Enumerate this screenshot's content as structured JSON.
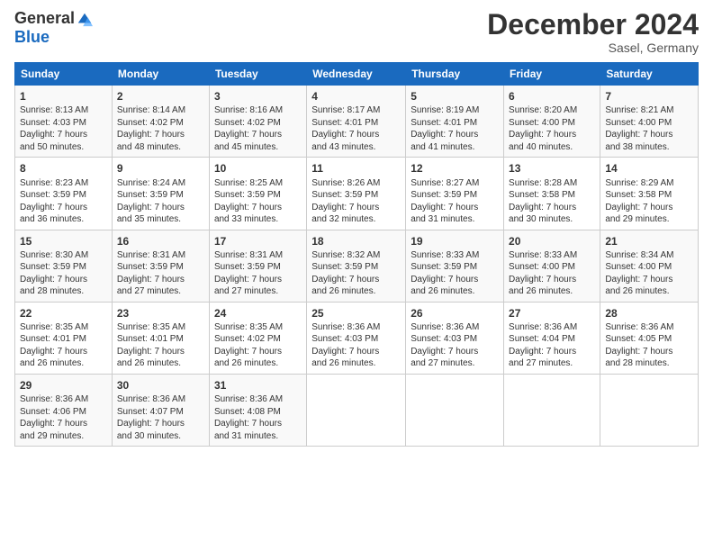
{
  "logo": {
    "general": "General",
    "blue": "Blue"
  },
  "header": {
    "month": "December 2024",
    "location": "Sasel, Germany"
  },
  "days_of_week": [
    "Sunday",
    "Monday",
    "Tuesday",
    "Wednesday",
    "Thursday",
    "Friday",
    "Saturday"
  ],
  "weeks": [
    [
      {
        "day": "1",
        "lines": [
          "Sunrise: 8:13 AM",
          "Sunset: 4:03 PM",
          "Daylight: 7 hours",
          "and 50 minutes."
        ]
      },
      {
        "day": "2",
        "lines": [
          "Sunrise: 8:14 AM",
          "Sunset: 4:02 PM",
          "Daylight: 7 hours",
          "and 48 minutes."
        ]
      },
      {
        "day": "3",
        "lines": [
          "Sunrise: 8:16 AM",
          "Sunset: 4:02 PM",
          "Daylight: 7 hours",
          "and 45 minutes."
        ]
      },
      {
        "day": "4",
        "lines": [
          "Sunrise: 8:17 AM",
          "Sunset: 4:01 PM",
          "Daylight: 7 hours",
          "and 43 minutes."
        ]
      },
      {
        "day": "5",
        "lines": [
          "Sunrise: 8:19 AM",
          "Sunset: 4:01 PM",
          "Daylight: 7 hours",
          "and 41 minutes."
        ]
      },
      {
        "day": "6",
        "lines": [
          "Sunrise: 8:20 AM",
          "Sunset: 4:00 PM",
          "Daylight: 7 hours",
          "and 40 minutes."
        ]
      },
      {
        "day": "7",
        "lines": [
          "Sunrise: 8:21 AM",
          "Sunset: 4:00 PM",
          "Daylight: 7 hours",
          "and 38 minutes."
        ]
      }
    ],
    [
      {
        "day": "8",
        "lines": [
          "Sunrise: 8:23 AM",
          "Sunset: 3:59 PM",
          "Daylight: 7 hours",
          "and 36 minutes."
        ]
      },
      {
        "day": "9",
        "lines": [
          "Sunrise: 8:24 AM",
          "Sunset: 3:59 PM",
          "Daylight: 7 hours",
          "and 35 minutes."
        ]
      },
      {
        "day": "10",
        "lines": [
          "Sunrise: 8:25 AM",
          "Sunset: 3:59 PM",
          "Daylight: 7 hours",
          "and 33 minutes."
        ]
      },
      {
        "day": "11",
        "lines": [
          "Sunrise: 8:26 AM",
          "Sunset: 3:59 PM",
          "Daylight: 7 hours",
          "and 32 minutes."
        ]
      },
      {
        "day": "12",
        "lines": [
          "Sunrise: 8:27 AM",
          "Sunset: 3:59 PM",
          "Daylight: 7 hours",
          "and 31 minutes."
        ]
      },
      {
        "day": "13",
        "lines": [
          "Sunrise: 8:28 AM",
          "Sunset: 3:58 PM",
          "Daylight: 7 hours",
          "and 30 minutes."
        ]
      },
      {
        "day": "14",
        "lines": [
          "Sunrise: 8:29 AM",
          "Sunset: 3:58 PM",
          "Daylight: 7 hours",
          "and 29 minutes."
        ]
      }
    ],
    [
      {
        "day": "15",
        "lines": [
          "Sunrise: 8:30 AM",
          "Sunset: 3:59 PM",
          "Daylight: 7 hours",
          "and 28 minutes."
        ]
      },
      {
        "day": "16",
        "lines": [
          "Sunrise: 8:31 AM",
          "Sunset: 3:59 PM",
          "Daylight: 7 hours",
          "and 27 minutes."
        ]
      },
      {
        "day": "17",
        "lines": [
          "Sunrise: 8:31 AM",
          "Sunset: 3:59 PM",
          "Daylight: 7 hours",
          "and 27 minutes."
        ]
      },
      {
        "day": "18",
        "lines": [
          "Sunrise: 8:32 AM",
          "Sunset: 3:59 PM",
          "Daylight: 7 hours",
          "and 26 minutes."
        ]
      },
      {
        "day": "19",
        "lines": [
          "Sunrise: 8:33 AM",
          "Sunset: 3:59 PM",
          "Daylight: 7 hours",
          "and 26 minutes."
        ]
      },
      {
        "day": "20",
        "lines": [
          "Sunrise: 8:33 AM",
          "Sunset: 4:00 PM",
          "Daylight: 7 hours",
          "and 26 minutes."
        ]
      },
      {
        "day": "21",
        "lines": [
          "Sunrise: 8:34 AM",
          "Sunset: 4:00 PM",
          "Daylight: 7 hours",
          "and 26 minutes."
        ]
      }
    ],
    [
      {
        "day": "22",
        "lines": [
          "Sunrise: 8:35 AM",
          "Sunset: 4:01 PM",
          "Daylight: 7 hours",
          "and 26 minutes."
        ]
      },
      {
        "day": "23",
        "lines": [
          "Sunrise: 8:35 AM",
          "Sunset: 4:01 PM",
          "Daylight: 7 hours",
          "and 26 minutes."
        ]
      },
      {
        "day": "24",
        "lines": [
          "Sunrise: 8:35 AM",
          "Sunset: 4:02 PM",
          "Daylight: 7 hours",
          "and 26 minutes."
        ]
      },
      {
        "day": "25",
        "lines": [
          "Sunrise: 8:36 AM",
          "Sunset: 4:03 PM",
          "Daylight: 7 hours",
          "and 26 minutes."
        ]
      },
      {
        "day": "26",
        "lines": [
          "Sunrise: 8:36 AM",
          "Sunset: 4:03 PM",
          "Daylight: 7 hours",
          "and 27 minutes."
        ]
      },
      {
        "day": "27",
        "lines": [
          "Sunrise: 8:36 AM",
          "Sunset: 4:04 PM",
          "Daylight: 7 hours",
          "and 27 minutes."
        ]
      },
      {
        "day": "28",
        "lines": [
          "Sunrise: 8:36 AM",
          "Sunset: 4:05 PM",
          "Daylight: 7 hours",
          "and 28 minutes."
        ]
      }
    ],
    [
      {
        "day": "29",
        "lines": [
          "Sunrise: 8:36 AM",
          "Sunset: 4:06 PM",
          "Daylight: 7 hours",
          "and 29 minutes."
        ]
      },
      {
        "day": "30",
        "lines": [
          "Sunrise: 8:36 AM",
          "Sunset: 4:07 PM",
          "Daylight: 7 hours",
          "and 30 minutes."
        ]
      },
      {
        "day": "31",
        "lines": [
          "Sunrise: 8:36 AM",
          "Sunset: 4:08 PM",
          "Daylight: 7 hours",
          "and 31 minutes."
        ]
      },
      {
        "day": "",
        "lines": []
      },
      {
        "day": "",
        "lines": []
      },
      {
        "day": "",
        "lines": []
      },
      {
        "day": "",
        "lines": []
      }
    ]
  ]
}
